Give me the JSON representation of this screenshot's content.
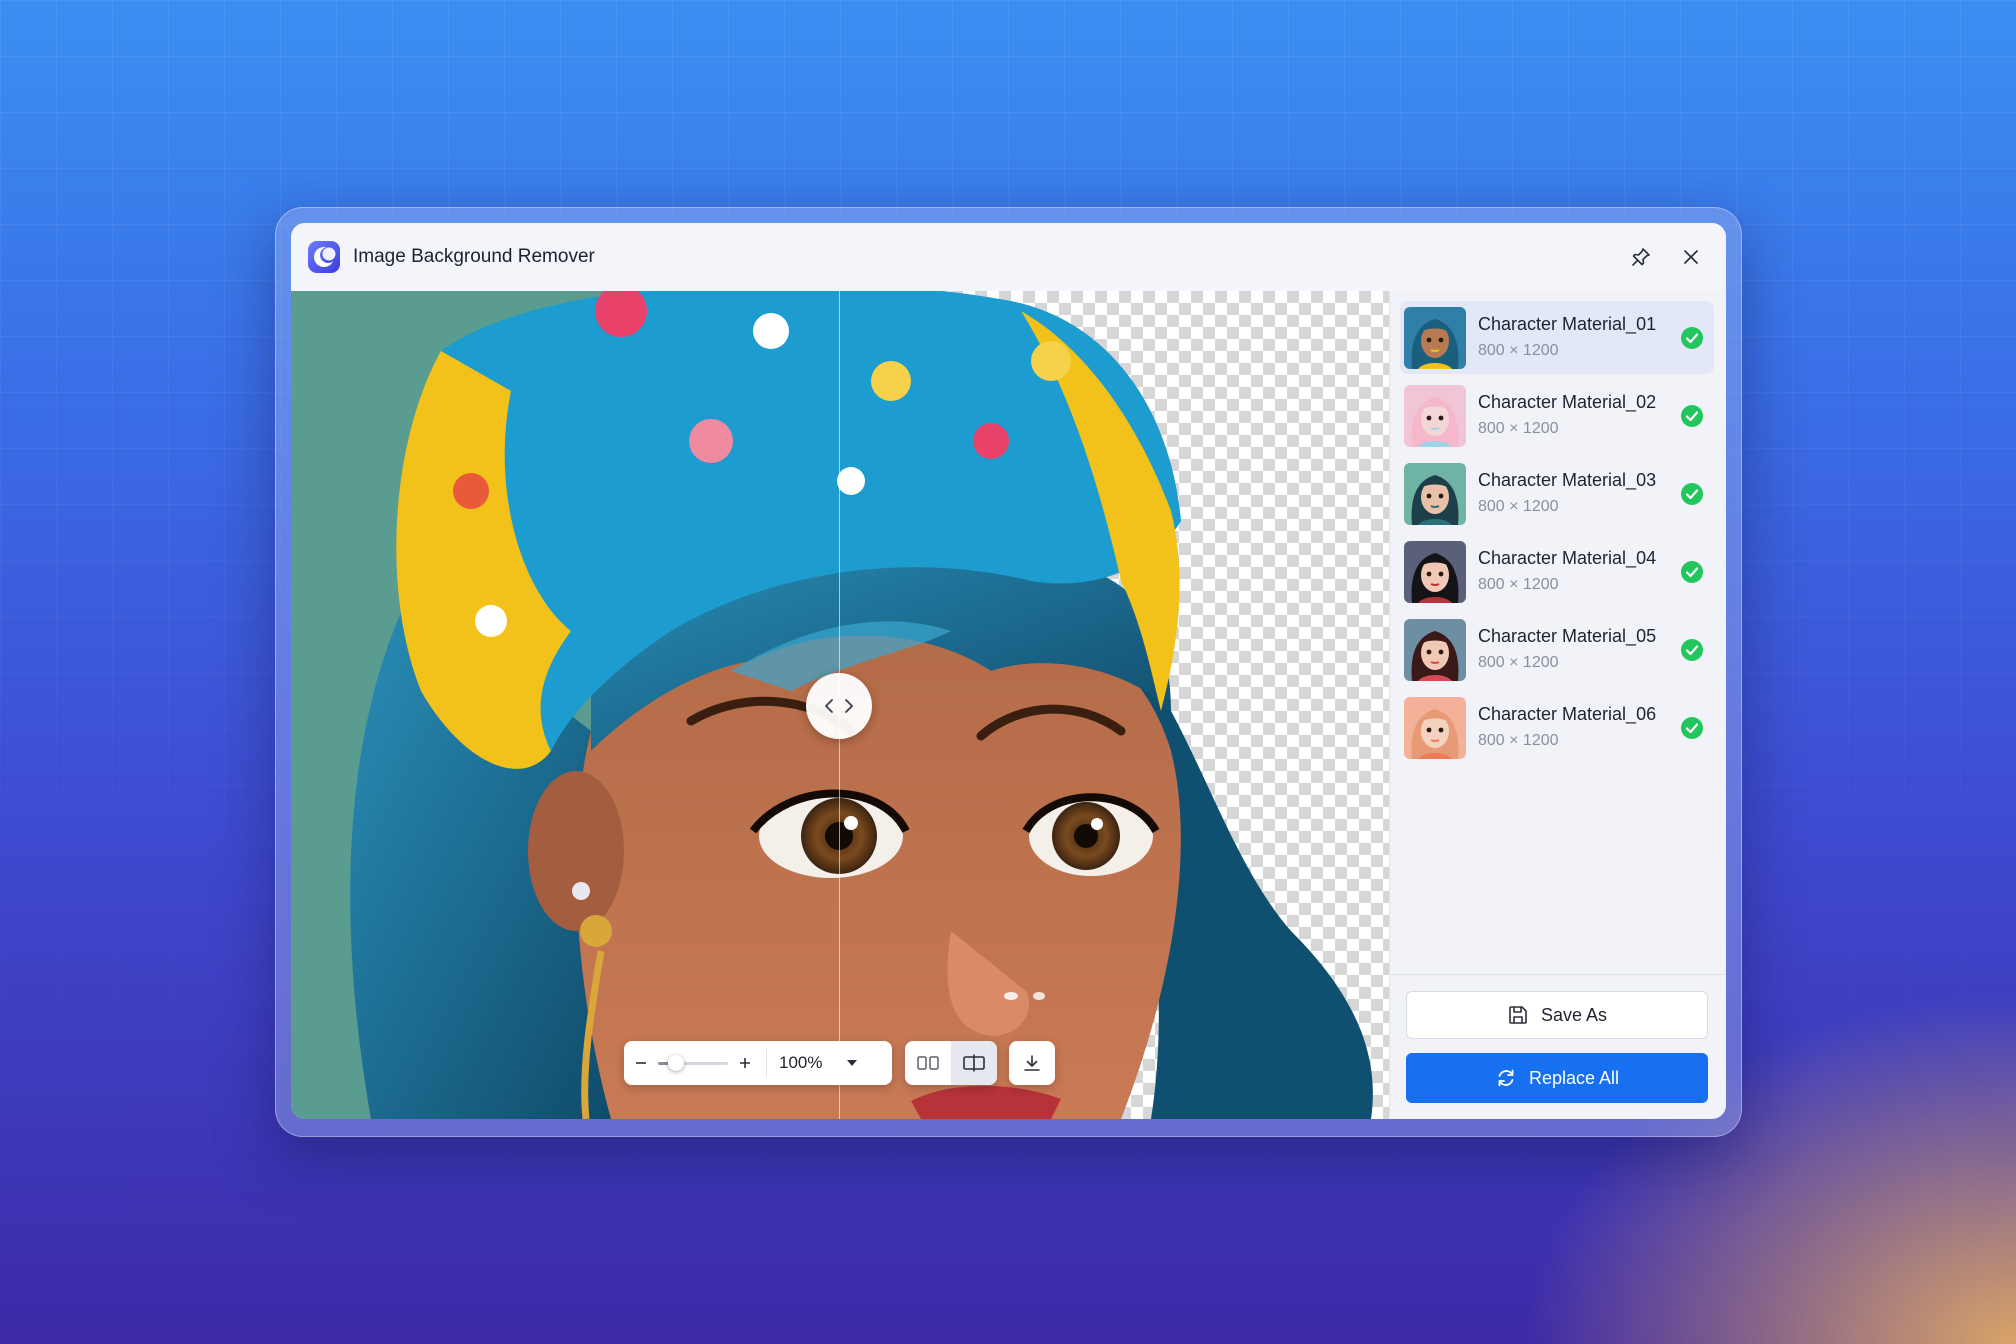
{
  "window": {
    "title": "Image Background Remover",
    "logo_icon": "app-logo-icon",
    "pin_icon": "pin-icon",
    "close_icon": "close-icon"
  },
  "preview": {
    "split_fraction": 0.5,
    "left_label": "original",
    "right_label": "background-removed"
  },
  "zoom": {
    "value_label": "100%",
    "slider_fraction": 0.25,
    "minus_icon": "minus-icon",
    "plus_icon": "plus-icon",
    "dropdown_icon": "caret-down-icon"
  },
  "files": [
    {
      "name": "Character Material_01",
      "size": "800 × 1200",
      "selected": true,
      "status": "done"
    },
    {
      "name": "Character Material_02",
      "size": "800 × 1200",
      "selected": false,
      "status": "done"
    },
    {
      "name": "Character Material_03",
      "size": "800 × 1200",
      "selected": false,
      "status": "done"
    },
    {
      "name": "Character Material_04",
      "size": "800 × 1200",
      "selected": false,
      "status": "done"
    },
    {
      "name": "Character Material_05",
      "size": "800 × 1200",
      "selected": false,
      "status": "done"
    },
    {
      "name": "Character Material_06",
      "size": "800 × 1200",
      "selected": false,
      "status": "done"
    }
  ],
  "actions": {
    "save_as": "Save As",
    "replace_all": "Replace All"
  },
  "colors": {
    "accent": "#1670f0",
    "success": "#22c55e",
    "selected_row": "#e2e8f8"
  }
}
